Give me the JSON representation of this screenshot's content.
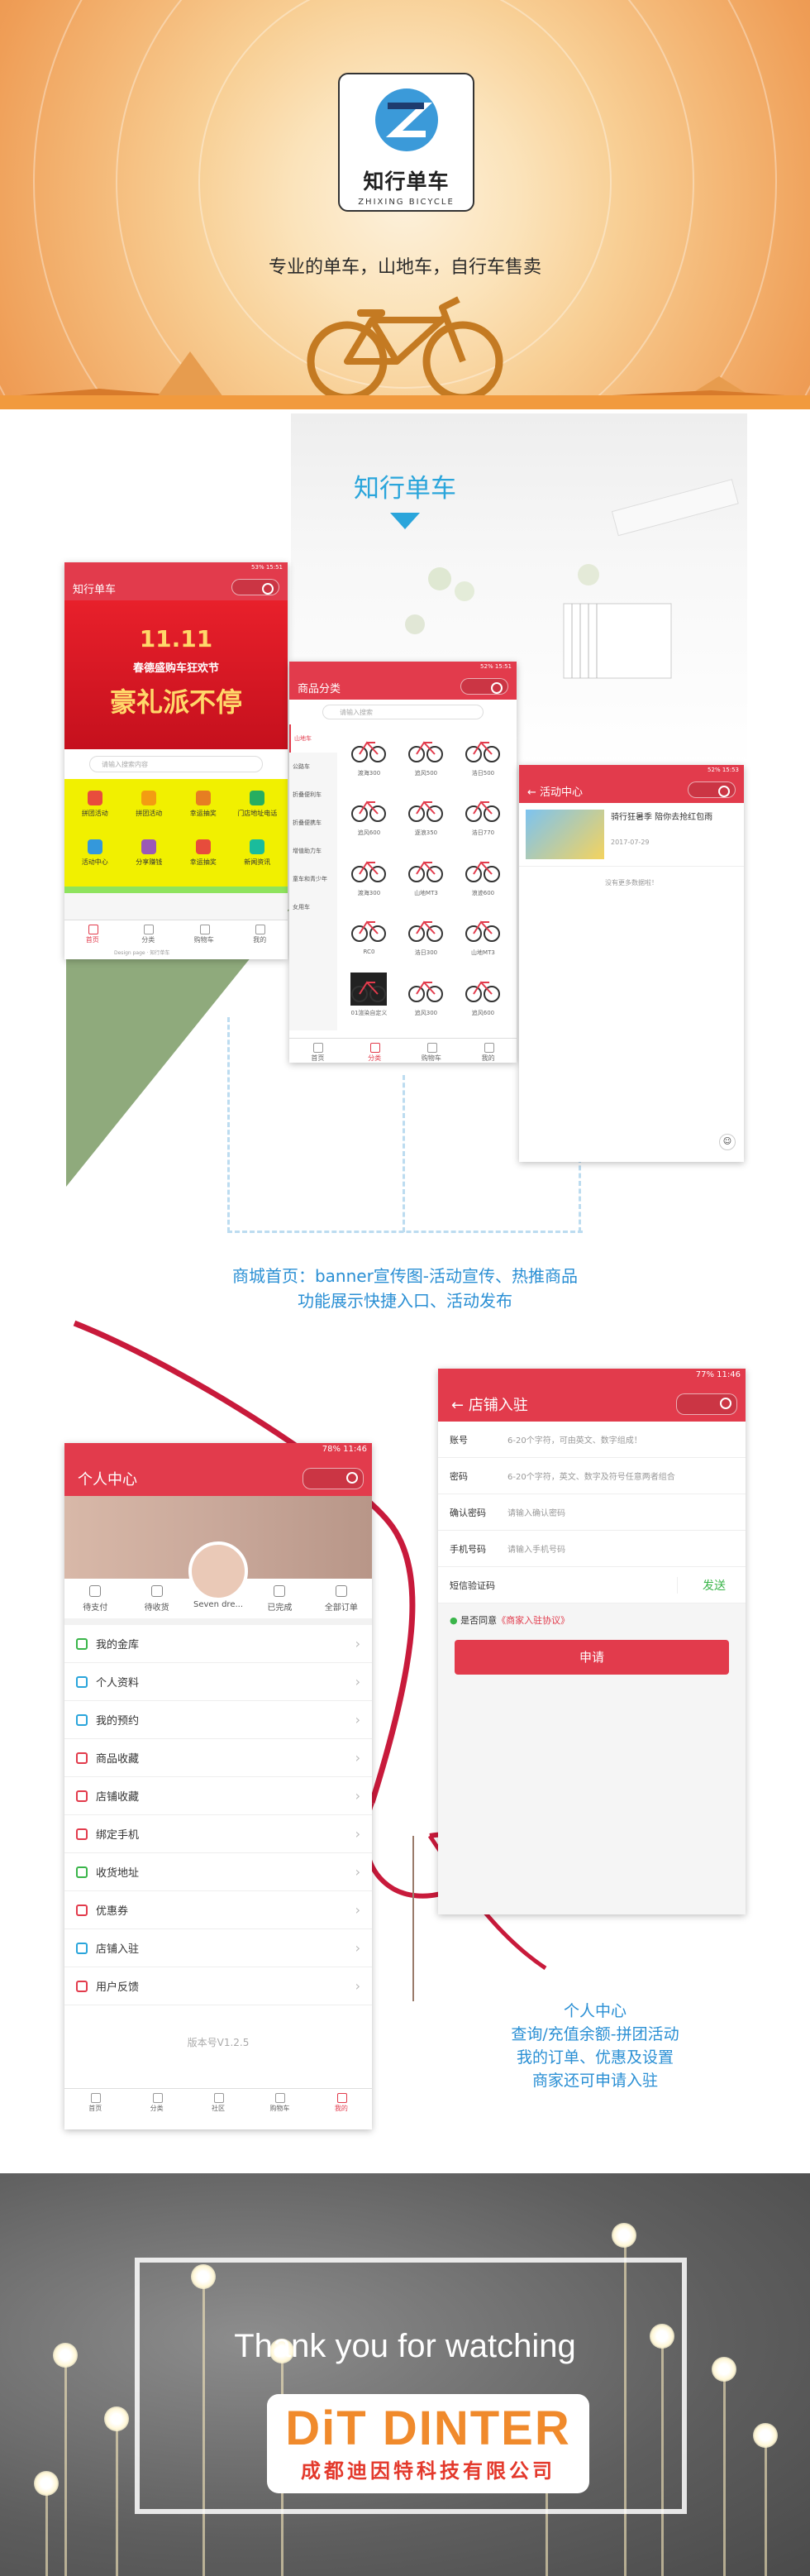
{
  "hero": {
    "logo_cn": "知行单车",
    "logo_en": "ZHIXING BICYCLE",
    "tagline": "专业的单车，山地车，自行车售卖"
  },
  "section2": {
    "title": "知行单车",
    "description_lines": [
      "商城首页：banner宣传图-活动宣传、热推商品",
      "功能展示快捷入口、活动发布"
    ]
  },
  "home_phone": {
    "status": "53% 15:51",
    "title": "知行单车",
    "banner_top": "11.11",
    "banner_line1": "春德盛购车狂欢节",
    "banner_line2": "豪礼派不停",
    "search_placeholder": "请输入搜索内容",
    "grid": [
      "拼团活动",
      "拼团活动",
      "幸运抽奖",
      "门店地址电话",
      "活动中心",
      "分享赚钱",
      "幸运抽奖",
      "新闻资讯"
    ],
    "tabs": [
      "首页",
      "分类",
      "购物车",
      "我的"
    ],
    "footer_text": "Design page · 知行单车"
  },
  "category_phone": {
    "status": "52% 15:51",
    "title": "商品分类",
    "search_placeholder": "请输入搜索",
    "categories": [
      "山地车",
      "公路车",
      "折叠便利车",
      "折叠便携车",
      "增值助力车",
      "童车和青少年",
      "女用车"
    ],
    "products": [
      "渡海300",
      "追风500",
      "浩日500",
      "追风600",
      "逐浪350",
      "浩日770",
      "渡海300",
      "山地MT3",
      "浪迹600",
      "RC0",
      "浩日300",
      "山地MT3",
      "01渲染自定义",
      "追风300",
      "追风600"
    ],
    "tabs": [
      "首页",
      "分类",
      "购物车",
      "我的"
    ]
  },
  "activity_phone": {
    "status": "52% 15:53",
    "title": "活动中心",
    "item_title": "骑行狂暑季 陪你去抢红包雨",
    "item_date": "2017-07-29",
    "no_more": "没有更多数据啦！"
  },
  "profile_phone": {
    "status": "78% 11:46",
    "title": "个人中心",
    "username": "Seven dre...",
    "orders": [
      "待支付",
      "待收货",
      "Seven dre...",
      "已完成",
      "全部订单"
    ],
    "menu": [
      "我的金库",
      "个人资料",
      "我的预约",
      "商品收藏",
      "店铺收藏",
      "绑定手机",
      "收货地址",
      "优惠券",
      "店铺入驻",
      "用户反馈"
    ],
    "version": "版本号V1.2.5",
    "tabs": [
      "首页",
      "分类",
      "社区",
      "购物车",
      "我的"
    ]
  },
  "register_phone": {
    "status": "77% 11:46",
    "title": "店铺入驻",
    "fields": [
      {
        "label": "账号",
        "placeholder": "6-20个字符，可由英文、数字组成！"
      },
      {
        "label": "密码",
        "placeholder": "6-20个字符，英文、数字及符号任意两者组合"
      },
      {
        "label": "确认密码",
        "placeholder": "请输入确认密码"
      },
      {
        "label": "手机号码",
        "placeholder": "请输入手机号码"
      },
      {
        "label": "短信验证码",
        "placeholder": ""
      }
    ],
    "send_code": "发送",
    "agree": "是否同意",
    "agree_link": "《商家入驻协议》",
    "submit": "申请"
  },
  "section3": {
    "description_lines": [
      "个人中心",
      "查询/充值余额-拼团活动",
      "我的订单、优惠及设置",
      "商家还可申请入驻"
    ]
  },
  "footer": {
    "thanks": "Thank you for watching",
    "brand": "DiT DINTER",
    "company": "成都迪因特科技有限公司"
  },
  "colors": {
    "accent": "#e23b4c",
    "blue": "#2aa5db",
    "orange": "#f08a2c"
  }
}
